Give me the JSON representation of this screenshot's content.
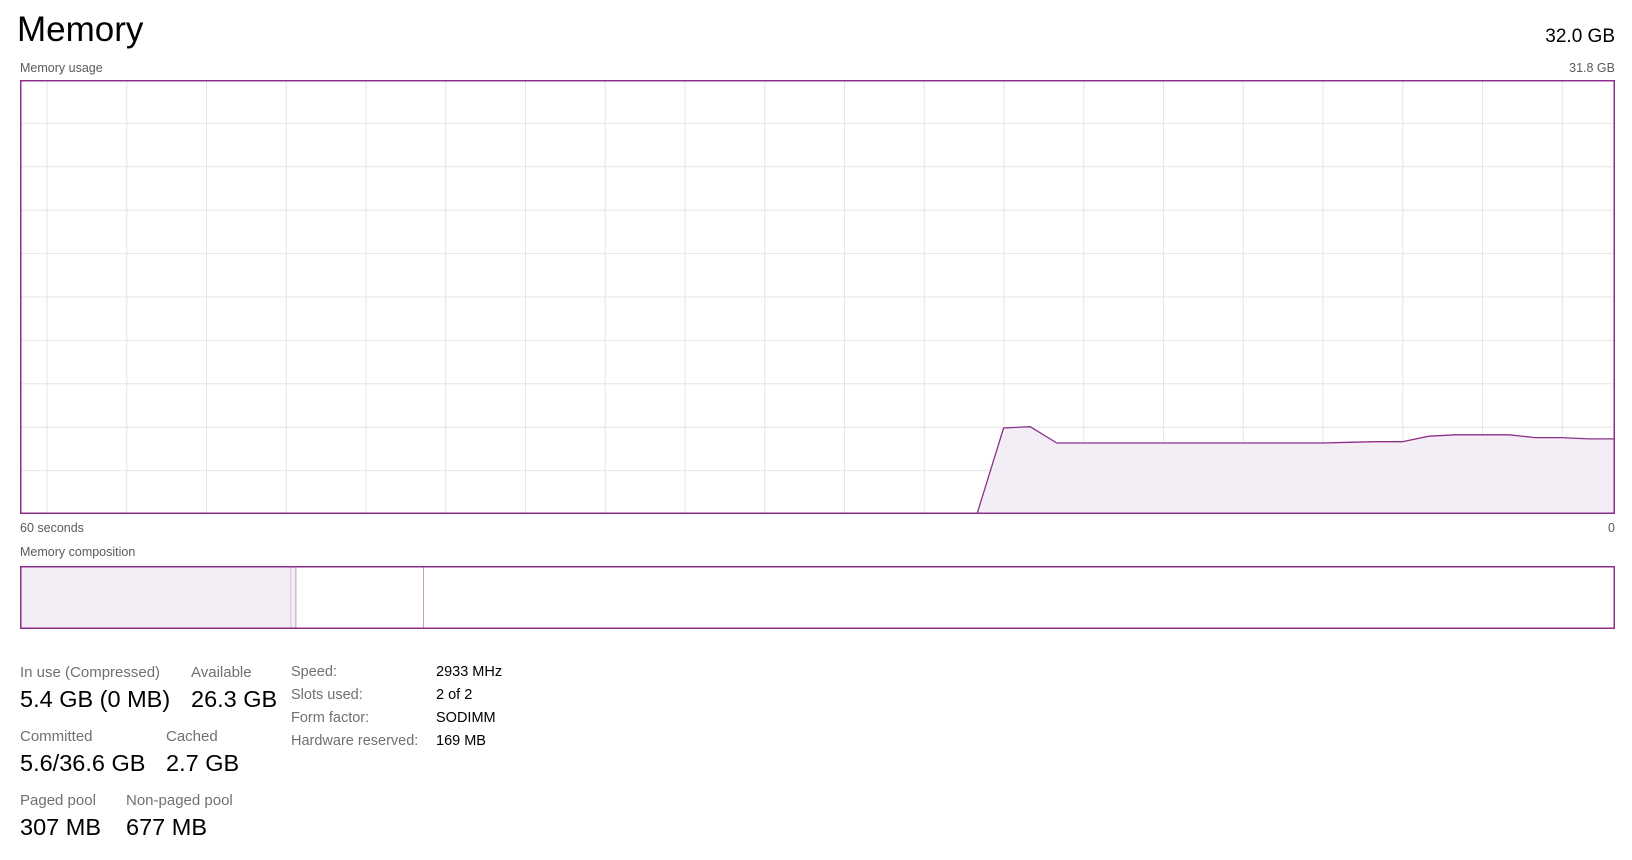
{
  "header": {
    "title": "Memory",
    "total": "32.0 GB"
  },
  "usage_chart": {
    "label": "Memory usage",
    "max_label": "31.8 GB",
    "x_left_label": "60 seconds",
    "x_right_label": "0"
  },
  "composition": {
    "label": "Memory composition",
    "in_use_fraction": 0.17,
    "modified_fraction": 0.003,
    "standby_fraction": 0.08
  },
  "stats": {
    "in_use": {
      "label": "In use (Compressed)",
      "value": "5.4 GB (0 MB)"
    },
    "available": {
      "label": "Available",
      "value": "26.3 GB"
    },
    "committed": {
      "label": "Committed",
      "value": "5.6/36.6 GB"
    },
    "cached": {
      "label": "Cached",
      "value": "2.7 GB"
    },
    "paged_pool": {
      "label": "Paged pool",
      "value": "307 MB"
    },
    "non_paged_pool": {
      "label": "Non-paged pool",
      "value": "677 MB"
    }
  },
  "properties": [
    {
      "key": "Speed:",
      "value": "2933 MHz"
    },
    {
      "key": "Slots used:",
      "value": "2 of 2"
    },
    {
      "key": "Form factor:",
      "value": "SODIMM"
    },
    {
      "key": "Hardware reserved:",
      "value": "169 MB"
    }
  ],
  "colors": {
    "accent": "#8b2f8b",
    "fill": "#f3eef5",
    "grid": "#e6e6e6"
  },
  "chart_data": {
    "type": "area",
    "x_range": [
      60,
      0
    ],
    "y_range": [
      0,
      31.8
    ],
    "x": [
      60,
      24,
      23,
      22,
      21,
      20,
      19,
      18,
      17,
      16,
      15,
      14,
      13,
      12,
      11,
      10,
      9,
      8,
      7,
      6,
      5,
      4,
      3,
      2,
      1,
      0
    ],
    "values": [
      0,
      0,
      6.3,
      6.4,
      5.2,
      5.2,
      5.2,
      5.2,
      5.2,
      5.2,
      5.2,
      5.2,
      5.2,
      5.2,
      5.2,
      5.25,
      5.3,
      5.3,
      5.7,
      5.8,
      5.8,
      5.8,
      5.6,
      5.6,
      5.5,
      5.5
    ],
    "grid": true
  }
}
